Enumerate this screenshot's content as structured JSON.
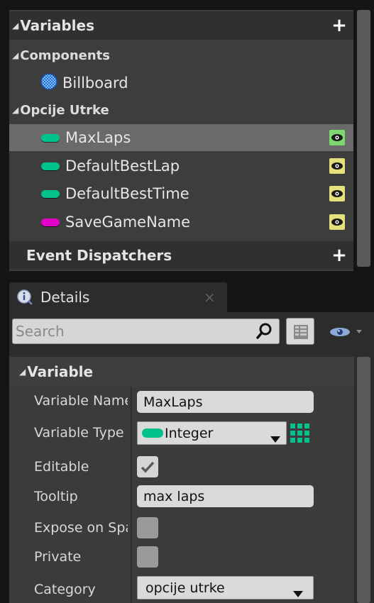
{
  "variables_section": {
    "title": "Variables"
  },
  "components": {
    "title": "Components",
    "items": [
      {
        "label": "Billboard",
        "icon": "billboard-icon"
      }
    ]
  },
  "opcije_utrke": {
    "title": "Opcije Utrke",
    "items": [
      {
        "label": "MaxLaps",
        "type_color": "#00c28a",
        "visibility_color": "#7dd86f",
        "selected": true
      },
      {
        "label": "DefaultBestLap",
        "type_color": "#00c28a",
        "visibility_color": "#e6e07a"
      },
      {
        "label": "DefaultBestTime",
        "type_color": "#00c28a",
        "visibility_color": "#e6e07a"
      },
      {
        "label": "SaveGameName",
        "type_color": "#e000c8",
        "visibility_color": "#e6e07a"
      }
    ]
  },
  "event_dispatchers": {
    "title": "Event Dispatchers"
  },
  "details_tab": {
    "label": "Details",
    "close_glyph": "×"
  },
  "search": {
    "placeholder": "Search",
    "value": ""
  },
  "variable_section": {
    "title": "Variable"
  },
  "properties": {
    "variable_name": {
      "label": "Variable Name",
      "value": "MaxLaps"
    },
    "variable_type": {
      "label": "Variable Type",
      "value": "Integer",
      "type_color": "#00c28a"
    },
    "editable": {
      "label": "Editable",
      "checked": true
    },
    "tooltip": {
      "label": "Tooltip",
      "value": "max laps"
    },
    "expose_on_spawn": {
      "label": "Expose on Spawn",
      "checked": false
    },
    "private": {
      "label": "Private",
      "checked": false
    },
    "category": {
      "label": "Category",
      "value": "opcije utrke"
    }
  },
  "colors": {
    "panel_bg": "#3d3d3d",
    "selected_row": "#6a6a6a",
    "integer_pin": "#00c28a",
    "string_pin": "#e000c8"
  }
}
